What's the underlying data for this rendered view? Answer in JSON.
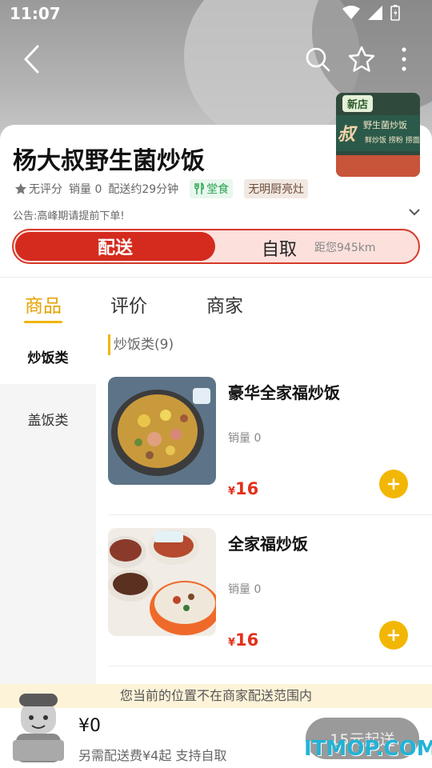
{
  "status": {
    "time": "11:07"
  },
  "store": {
    "name": "杨大叔野生菌炒饭",
    "rating": "无评分",
    "sales": "销量 0",
    "delivery_time": "配送约29分钟",
    "tag_dine": "堂食",
    "tag_kitchen": "无明厨亮灶",
    "notice": "公告:高峰期请提前下单!",
    "thumb_new": "新店",
    "thumb_sign_char": "叔",
    "thumb_sign_text": "野生菌炒饭",
    "thumb_sign_sub": "鲜炒饭 捞粉 捞面"
  },
  "mode": {
    "delivery": "配送",
    "self_pickup": "自取",
    "distance": "距您945km"
  },
  "tabs": [
    "商品",
    "评价",
    "商家"
  ],
  "categories": [
    "炒饭类",
    "盖饭类"
  ],
  "section_title": "炒饭类(9)",
  "dishes": [
    {
      "name": "豪华全家福炒饭",
      "sales": "销量 0",
      "currency": "¥",
      "price": "16"
    },
    {
      "name": "全家福炒饭",
      "sales": "销量 0",
      "currency": "¥",
      "price": "16"
    }
  ],
  "warning": "您当前的位置不在商家配送范围内",
  "cart": {
    "total": "¥0",
    "sub": "另需配送费¥4起  支持自取",
    "cta": "15元起送"
  },
  "watermark": "ITMOP.COM",
  "colors": {
    "accent": "#f0b400",
    "primary_red": "#d42b1e",
    "price": "#e2311e"
  }
}
